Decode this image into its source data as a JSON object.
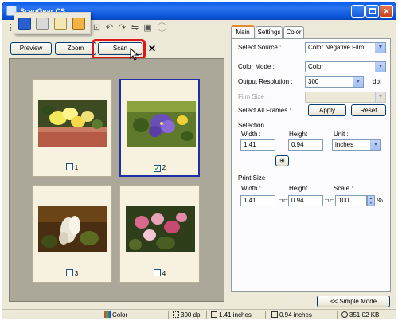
{
  "window": {
    "title": "ScanGear CS"
  },
  "left": {
    "preview_label": "Preview",
    "zoom_label": "Zoom",
    "scan_label": "Scan",
    "frames": [
      {
        "label": "1",
        "checked": false
      },
      {
        "label": "2",
        "checked": true
      },
      {
        "label": "3",
        "checked": false
      },
      {
        "label": "4",
        "checked": false
      }
    ]
  },
  "tabs": [
    {
      "label": "Main"
    },
    {
      "label": "Settings"
    },
    {
      "label": "Color"
    }
  ],
  "main": {
    "select_source_label": "Select Source :",
    "select_source_value": "Color Negative Film",
    "color_mode_label": "Color Mode :",
    "color_mode_value": "Color",
    "output_resolution_label": "Output Resolution :",
    "output_resolution_value": "300",
    "output_resolution_unit": "dpi",
    "film_size_label": "Film Size :",
    "film_size_value": "",
    "select_all_frames_label": "Select All Frames :",
    "apply_label": "Apply",
    "reset_label": "Reset",
    "selection_heading": "Selection",
    "width_label": "Width :",
    "height_label": "Height :",
    "unit_label": "Unit :",
    "sel_width": "1.41",
    "sel_height": "0.94",
    "unit_value": "inches",
    "print_size_heading": "Print Size",
    "print_width_label": "Width :",
    "print_height_label": "Height :",
    "scale_label": "Scale :",
    "print_width": "1.41",
    "print_height": "0.94",
    "scale_value": "100",
    "scale_unit": "%"
  },
  "simple_mode_label": "<< Simple Mode",
  "status": {
    "color": "Color",
    "dpi": "300 dpi",
    "width": "1.41 inches",
    "height": "0.94 inches",
    "size": "351.02 KB"
  }
}
